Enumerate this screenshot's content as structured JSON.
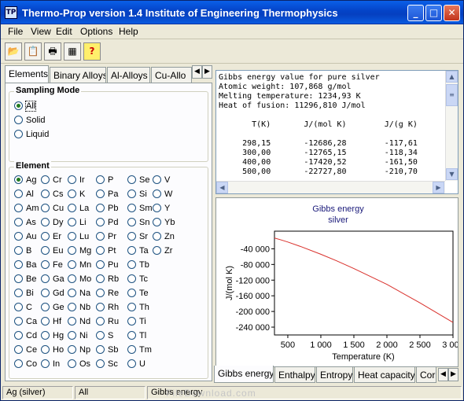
{
  "window": {
    "title": "Thermo-Prop version 1.4  Institute of Engineering Thermophysics",
    "icon_label": "TP",
    "controls": {
      "minimize": "_",
      "maximize": "□",
      "close": "✕"
    }
  },
  "menu": [
    "File",
    "View",
    "Edit",
    "Options",
    "Help"
  ],
  "toolbar": {
    "buttons": [
      {
        "name": "open-icon",
        "glyph": "📂"
      },
      {
        "name": "copy-icon",
        "glyph": "📋"
      },
      {
        "name": "print-icon",
        "glyph": "🖶"
      },
      {
        "name": "calculator-icon",
        "glyph": "▦"
      },
      {
        "name": "help-icon",
        "glyph": "?"
      }
    ]
  },
  "left_tabs": [
    "Elements",
    "Binary Alloys",
    "Al-Alloys",
    "Cu-Allo"
  ],
  "tab_arrows": {
    "left": "◀",
    "right": "▶"
  },
  "sampling": {
    "title": "Sampling Mode",
    "options": [
      "All",
      "Solid",
      "Liquid"
    ],
    "selected": "All"
  },
  "elements": {
    "title": "Element",
    "selected": "Ag",
    "rows": [
      [
        "Ag",
        "Cr",
        "Ir",
        "P",
        "Se",
        "V"
      ],
      [
        "Al",
        "Cs",
        "K",
        "Pa",
        "Si",
        "W"
      ],
      [
        "Am",
        "Cu",
        "La",
        "Pb",
        "Sm",
        "Y"
      ],
      [
        "As",
        "Dy",
        "Li",
        "Pd",
        "Sn",
        "Yb"
      ],
      [
        "Au",
        "Er",
        "Lu",
        "Pr",
        "Sr",
        "Zn"
      ],
      [
        "B",
        "Eu",
        "Mg",
        "Pt",
        "Ta",
        "Zr"
      ],
      [
        "Ba",
        "Fe",
        "Mn",
        "Pu",
        "Tb"
      ],
      [
        "Be",
        "Ga",
        "Mo",
        "Rb",
        "Tc"
      ],
      [
        "Bi",
        "Gd",
        "Na",
        "Re",
        "Te"
      ],
      [
        "C",
        "Ge",
        "Nb",
        "Rh",
        "Th"
      ],
      [
        "Ca",
        "Hf",
        "Nd",
        "Ru",
        "Ti"
      ],
      [
        "Cd",
        "Hg",
        "Ni",
        "S",
        "Tl"
      ],
      [
        "Ce",
        "Ho",
        "Np",
        "Sb",
        "Tm"
      ],
      [
        "Co",
        "In",
        "Os",
        "Sc",
        "U"
      ]
    ]
  },
  "info_text": "Gibbs energy value for pure silver\nAtomic weight: 107,868 g/mol\nMelting temperature: 1234,93 K\nHeat of fusion: 11296,810 J/mol\n\n       T(K)       J/(mol K)        J/(g K)\n\n     298,15       -12686,28        -117,61\n     300,00       -12765,15        -118,34\n     400,00       -17420,52        -161,50\n     500,00       -22727,80        -210,70",
  "scroll": {
    "up": "▲",
    "down": "▼",
    "left": "◀",
    "right": "▶",
    "grip": "≡"
  },
  "chart_data": {
    "type": "line",
    "title": "Gibbs energy",
    "subtitle": "silver",
    "xlabel": "Temperature (K)",
    "ylabel": "J/(mol K)",
    "xlim": [
      298.15,
      3000
    ],
    "ylim": [
      -260000,
      5000
    ],
    "xticks": [
      500,
      1000,
      1500,
      2000,
      2500,
      3000
    ],
    "xtick_labels": [
      "500",
      "1 000",
      "1 500",
      "2 000",
      "2 500",
      "3 000"
    ],
    "yticks": [
      -40000,
      -80000,
      -120000,
      -160000,
      -200000,
      -240000
    ],
    "ytick_labels": [
      "-40 000",
      "-80 000",
      "-120 000",
      "-160 000",
      "-200 000",
      "-240 000"
    ],
    "series": [
      {
        "color": "#d9302b",
        "x": [
          298.15,
          300,
          400,
          500,
          700,
          1000,
          1234.93,
          1500,
          2000,
          2500,
          3000
        ],
        "values": [
          -12686.28,
          -12765.15,
          -17420.52,
          -22727.8,
          -34500,
          -54000,
          -70500,
          -90500,
          -131000,
          -178000,
          -228000
        ]
      }
    ],
    "grid": false
  },
  "right_tabs": [
    "Gibbs energy",
    "Enthalpy",
    "Entropy",
    "Heat capacity",
    "Cor"
  ],
  "status": [
    "Ag (silver)",
    "All",
    "Gibbs energy"
  ],
  "watermark": "FileDownload.com"
}
